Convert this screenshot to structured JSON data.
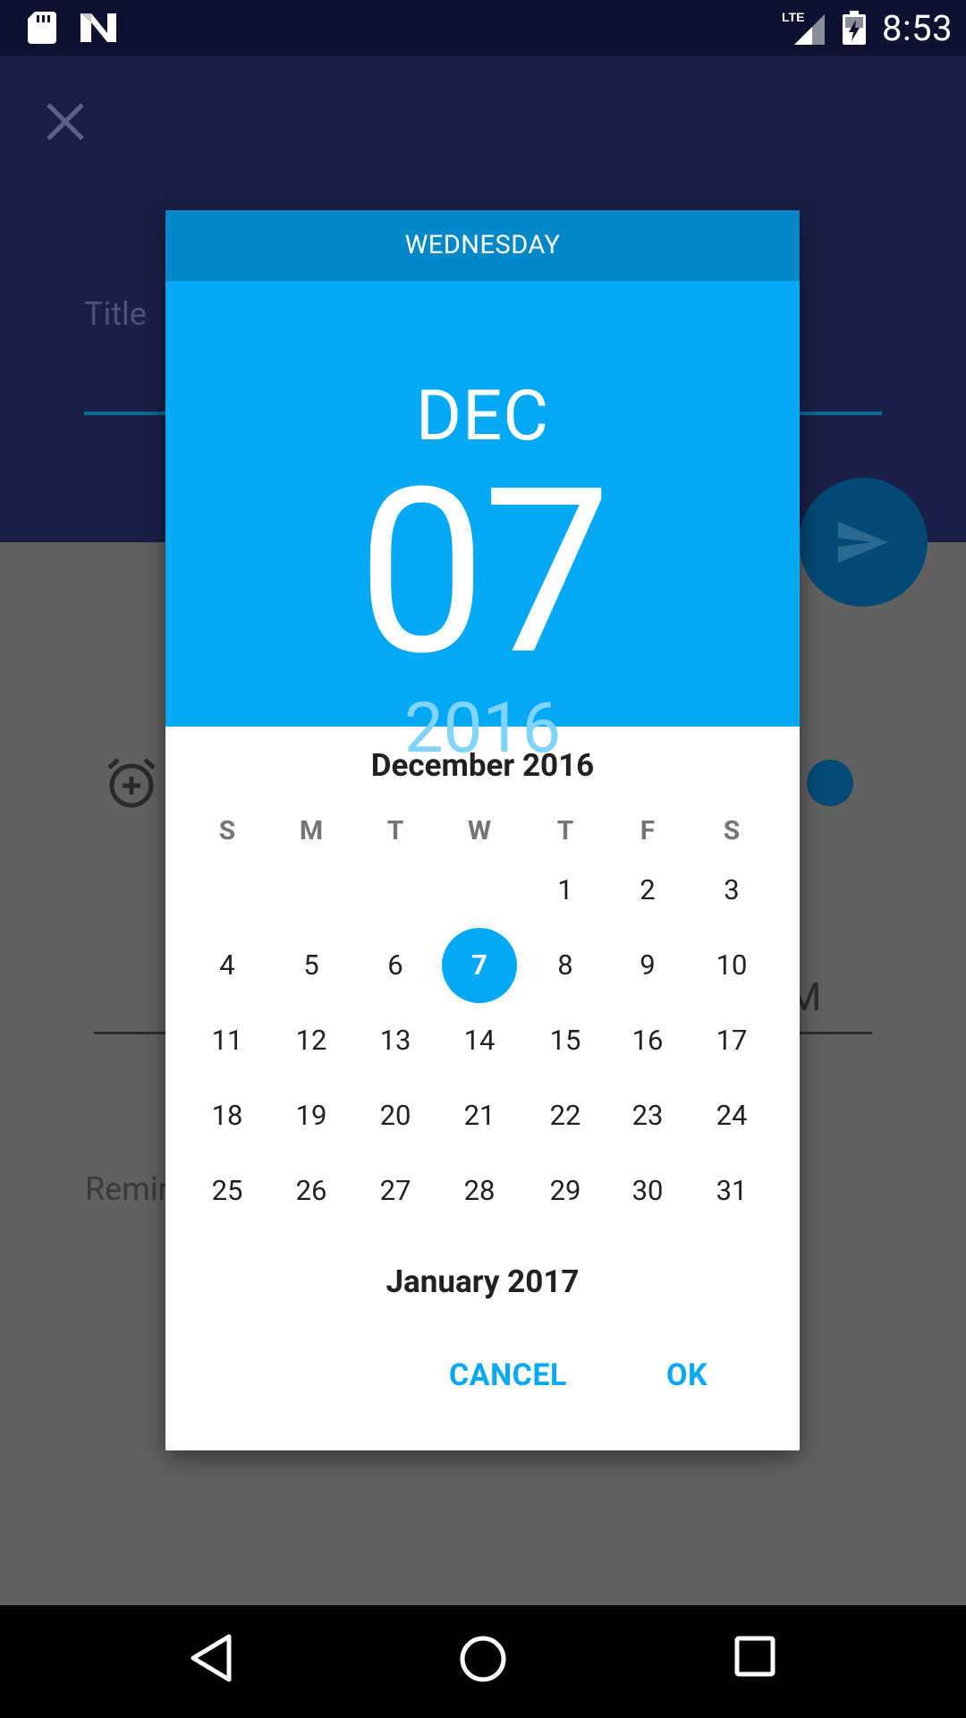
{
  "status_bar": {
    "time": "8:53",
    "icons": [
      "sd-card-icon",
      "n-logo-icon",
      "lte-signal-icon",
      "battery-charging-icon"
    ]
  },
  "background": {
    "title_label": "Title",
    "partial_text_m": "M",
    "partial_text_remind": "Remin",
    "accent": "#1a1f47"
  },
  "dialog": {
    "day_of_week": "WEDNESDAY",
    "month_short": "DEC",
    "day_number": "07",
    "year": "2016",
    "calendar_title": "December 2016",
    "weekdays": [
      "S",
      "M",
      "T",
      "W",
      "T",
      "F",
      "S"
    ],
    "days": [
      "1",
      "2",
      "3",
      "4",
      "5",
      "6",
      "7",
      "8",
      "9",
      "10",
      "11",
      "12",
      "13",
      "14",
      "15",
      "16",
      "17",
      "18",
      "19",
      "20",
      "21",
      "22",
      "23",
      "24",
      "25",
      "26",
      "27",
      "28",
      "29",
      "30",
      "31"
    ],
    "first_weekday_index": 4,
    "selected_day": "7",
    "next_month_title": "January 2017",
    "cancel_label": "CANCEL",
    "ok_label": "OK",
    "accent_color": "#03a9f4",
    "header_dark_color": "#0288c9"
  },
  "nav_bar": {
    "icons": [
      "back-icon",
      "home-icon",
      "recents-icon"
    ]
  }
}
